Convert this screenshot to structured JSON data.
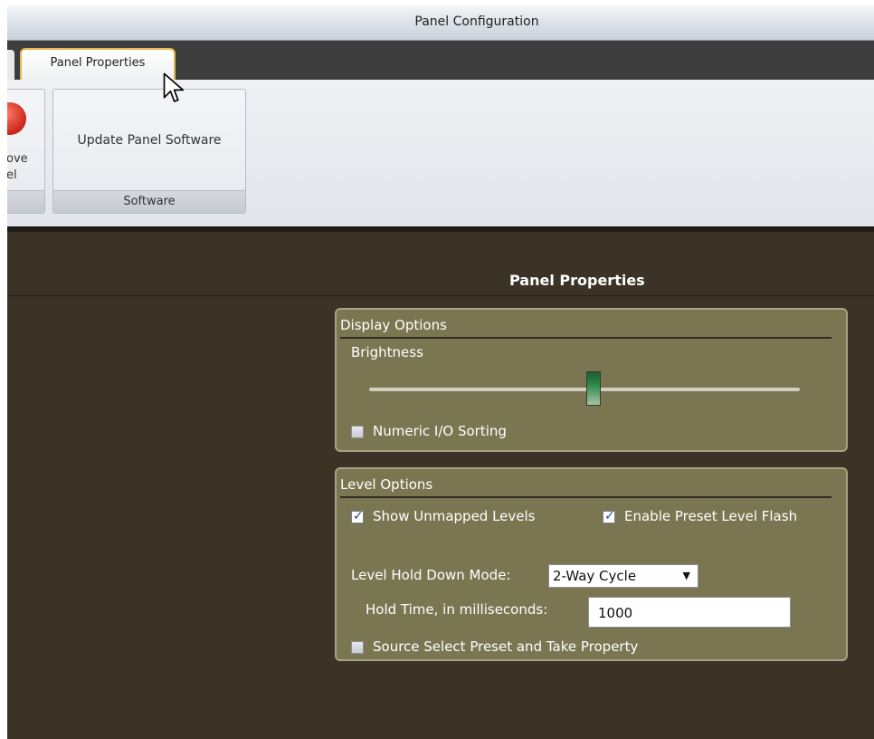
{
  "window": {
    "title": "Panel Configuration"
  },
  "tabs": [
    {
      "label": "Panel Properties",
      "active": true
    }
  ],
  "ribbon": {
    "remove_group": {
      "label_line1": "ove",
      "label_line2": "el"
    },
    "software_group": {
      "button_label": "Update Panel Software",
      "group_label": "Software"
    }
  },
  "content": {
    "title": "Panel Properties",
    "display_options": {
      "header": "Display Options",
      "brightness_label": "Brightness",
      "brightness_level": 0.52,
      "numeric_sorting": {
        "label": "Numeric I/O Sorting",
        "checked": false
      }
    },
    "level_options": {
      "header": "Level Options",
      "show_unmapped": {
        "label": "Show Unmapped Levels",
        "checked": true
      },
      "enable_preset_flash": {
        "label": "Enable Preset Level Flash",
        "checked": true
      },
      "hold_down_mode": {
        "label": "Level Hold Down Mode:",
        "selected": "2-Way Cycle"
      },
      "hold_time": {
        "label": "Hold Time, in milliseconds:",
        "value": "1000"
      },
      "source_select": {
        "label": "Source Select Preset and Take Property",
        "checked": false
      }
    }
  },
  "colors": {
    "background": "#3b3326",
    "group_box": "#7b7652",
    "tab_border": "#e8b84c"
  }
}
